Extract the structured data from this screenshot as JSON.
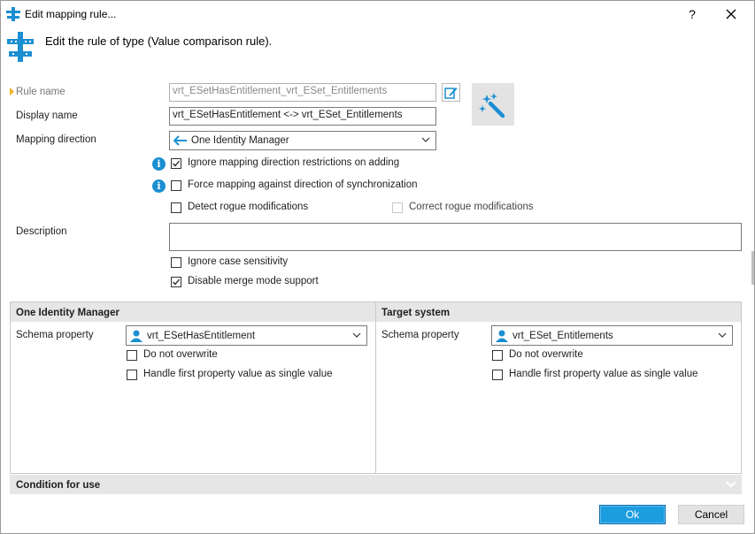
{
  "window": {
    "title": "Edit mapping rule...",
    "help_label": "?",
    "close_label": "✕"
  },
  "header": {
    "text": "Edit the rule of type (Value comparison rule)."
  },
  "form": {
    "rule_name_label": "Rule name",
    "rule_name_value": "vrt_ESetHasEntitlement_vrt_ESet_Entitlements",
    "display_name_label": "Display name",
    "display_name_value": "vrt_ESetHasEntitlement <-> vrt_ESet_Entitlements",
    "mapping_direction_label": "Mapping direction",
    "mapping_direction_value": "One Identity Manager",
    "ignore_direction_label": "Ignore mapping direction restrictions on adding",
    "ignore_direction_checked": true,
    "force_mapping_label": "Force mapping against direction of synchronization",
    "force_mapping_checked": false,
    "detect_rogue_label": "Detect rogue modifications",
    "detect_rogue_checked": false,
    "correct_rogue_label": "Correct rogue modifications",
    "correct_rogue_checked": false,
    "description_label": "Description",
    "description_value": "",
    "ignore_case_label": "Ignore case sensitivity",
    "ignore_case_checked": false,
    "disable_merge_label": "Disable merge mode support",
    "disable_merge_checked": true
  },
  "left_panel": {
    "title": "One Identity Manager",
    "schema_label": "Schema property",
    "schema_value": "vrt_ESetHasEntitlement",
    "do_not_overwrite_label": "Do not overwrite",
    "handle_first_label": "Handle first property value as single value"
  },
  "right_panel": {
    "title": "Target system",
    "schema_label": "Schema property",
    "schema_value": "vrt_ESet_Entitlements",
    "do_not_overwrite_label": "Do not overwrite",
    "handle_first_label": "Handle first property value as single value"
  },
  "condition": {
    "title": "Condition for use"
  },
  "buttons": {
    "ok_label": "Ok",
    "cancel_label": "Cancel"
  },
  "colors": {
    "accent": "#1c9ddf",
    "info": "#1b8fd2",
    "panel_header": "#e6e6e6",
    "required_marker": "#f0b429"
  }
}
